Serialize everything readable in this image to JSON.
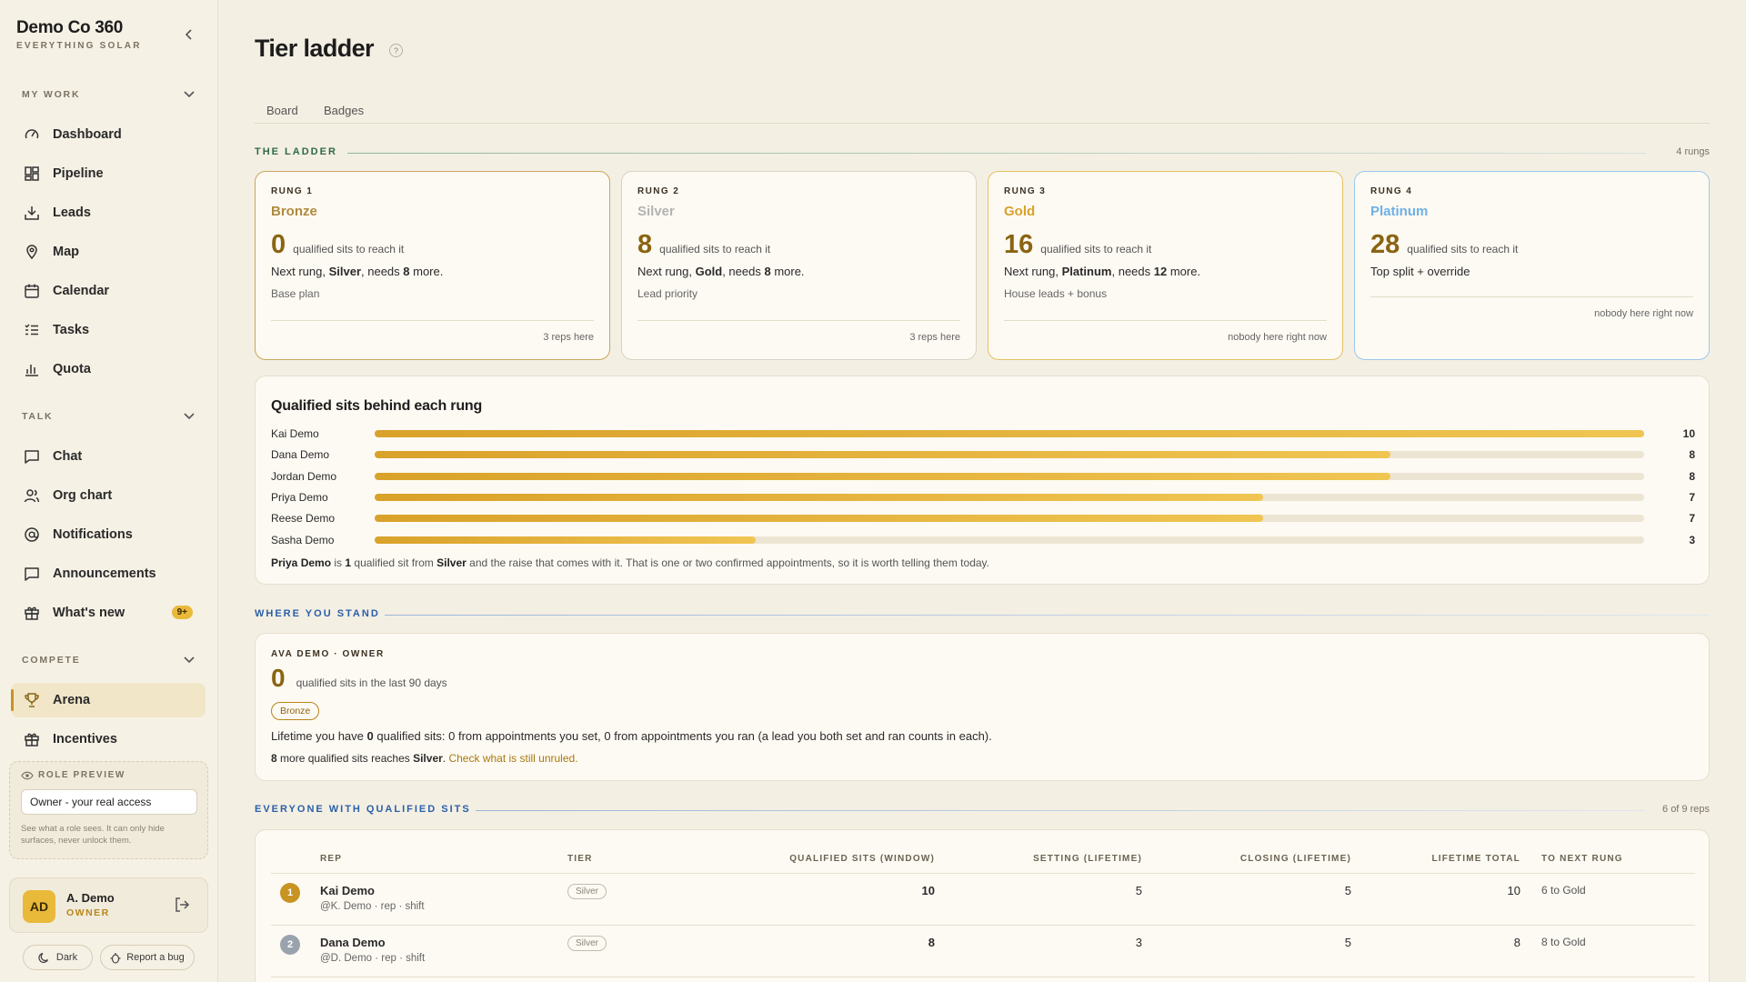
{
  "sidebar": {
    "brand_name": "Demo Co 360",
    "brand_sub": "EVERYTHING SOLAR",
    "sections": {
      "my_work": "MY WORK",
      "talk": "TALK",
      "compete": "COMPETE"
    },
    "items": [
      {
        "label": "Dashboard",
        "icon": "dashboard-icon"
      },
      {
        "label": "Pipeline",
        "icon": "pipeline-icon"
      },
      {
        "label": "Leads",
        "icon": "leads-icon"
      },
      {
        "label": "Map",
        "icon": "map-pin-icon"
      },
      {
        "label": "Calendar",
        "icon": "calendar-icon"
      },
      {
        "label": "Tasks",
        "icon": "tasks-icon"
      },
      {
        "label": "Quota",
        "icon": "bar-chart-icon"
      },
      {
        "label": "Chat",
        "icon": "chat-icon"
      },
      {
        "label": "Org chart",
        "icon": "users-icon"
      },
      {
        "label": "Notifications",
        "icon": "at-icon"
      },
      {
        "label": "Announcements",
        "icon": "message-icon"
      },
      {
        "label": "What's new",
        "icon": "gift-icon",
        "badge": "9+"
      },
      {
        "label": "Arena",
        "icon": "trophy-icon",
        "active": true
      },
      {
        "label": "Incentives",
        "icon": "gift-icon"
      }
    ],
    "role_preview": {
      "title": "ROLE PREVIEW",
      "value": "Owner - your real access",
      "help": "See what a role sees. It can only hide surfaces, never unlock them."
    },
    "user": {
      "initials": "AD",
      "name": "A. Demo",
      "role": "OWNER"
    },
    "dark_label": "Dark",
    "bug_label": "Report a bug"
  },
  "page": {
    "title": "Tier ladder",
    "help": "?",
    "tabs": [
      "Board",
      "Badges"
    ]
  },
  "ladder": {
    "label": "THE LADDER",
    "count": "4 rungs",
    "rungs": [
      {
        "n": "RUNG 1",
        "name": "Bronze",
        "color": "#b08a3e",
        "value": "0",
        "value_text": "qualified sits to reach it",
        "next_a": "Next rung, ",
        "next_tier": "Silver",
        "next_b": ", needs ",
        "next_num": "8",
        "next_c": " more.",
        "perk": "Base plan",
        "reps": "3 reps here",
        "border": "#c9a55a"
      },
      {
        "n": "RUNG 2",
        "name": "Silver",
        "color": "#b3b3b3",
        "value": "8",
        "value_text": "qualified sits to reach it",
        "next_a": "Next rung, ",
        "next_tier": "Gold",
        "next_b": ", needs ",
        "next_num": "8",
        "next_c": " more.",
        "perk": "Lead priority",
        "reps": "3 reps here",
        "border": "#d8d2c4"
      },
      {
        "n": "RUNG 3",
        "name": "Gold",
        "color": "#d9a22a",
        "value": "16",
        "value_text": "qualified sits to reach it",
        "next_a": "Next rung, ",
        "next_tier": "Platinum",
        "next_b": ", needs ",
        "next_num": "12",
        "next_c": " more.",
        "perk": "House leads + bonus",
        "reps": "nobody here right now",
        "border": "#e6c060"
      },
      {
        "n": "RUNG 4",
        "name": "Platinum",
        "color": "#6fb0e6",
        "value": "28",
        "value_text": "qualified sits to reach it",
        "perk": "Top split + override",
        "reps": "nobody here right now",
        "border": "#9cc8ee"
      }
    ]
  },
  "bars": {
    "title": "Qualified sits behind each rung",
    "max": 10,
    "rows": [
      {
        "name": "Kai Demo",
        "value": 10
      },
      {
        "name": "Dana Demo",
        "value": 8
      },
      {
        "name": "Jordan Demo",
        "value": 8
      },
      {
        "name": "Priya Demo",
        "value": 7
      },
      {
        "name": "Reese Demo",
        "value": 7
      },
      {
        "name": "Sasha Demo",
        "value": 3
      }
    ],
    "note": {
      "name": "Priya Demo",
      "a": " is ",
      "num": "1",
      "b": " qualified sit from ",
      "tier": "Silver",
      "c": " and the raise that comes with it. That is one or two confirmed appointments, so it is worth telling them today."
    }
  },
  "stand": {
    "label": "WHERE YOU STAND",
    "head": "AVA DEMO · OWNER",
    "value": "0",
    "value_text": "qualified sits in the last 90 days",
    "tier": "Bronze",
    "line_a": "Lifetime you have ",
    "line_num": "0",
    "line_b": " qualified sits: 0 from appointments you set, 0 from appointments you ran (a lead you both set and ran counts in each).",
    "line2_num": "8",
    "line2_a": " more qualified sits reaches ",
    "line2_tier": "Silver",
    "line2_b": ". ",
    "line2_link": "Check what is still unruled."
  },
  "table": {
    "label": "EVERYONE WITH QUALIFIED SITS",
    "count": "6 of 9 reps",
    "headers": [
      "REP",
      "TIER",
      "QUALIFIED SITS (WINDOW)",
      "SETTING (LIFETIME)",
      "CLOSING (LIFETIME)",
      "LIFETIME TOTAL",
      "TO NEXT RUNG"
    ],
    "rows": [
      {
        "rank": "1",
        "rank_color": "#c89321",
        "name": "Kai Demo",
        "sub": "@K. Demo · rep · shift",
        "tier": "Silver",
        "window": "10",
        "setting": "5",
        "closing": "5",
        "total": "10",
        "next": "6 to Gold"
      },
      {
        "rank": "2",
        "rank_color": "#9aa3ad",
        "name": "Dana Demo",
        "sub": "@D. Demo · rep · shift",
        "tier": "Silver",
        "window": "8",
        "setting": "3",
        "closing": "5",
        "total": "8",
        "next": "8 to Gold"
      }
    ]
  }
}
